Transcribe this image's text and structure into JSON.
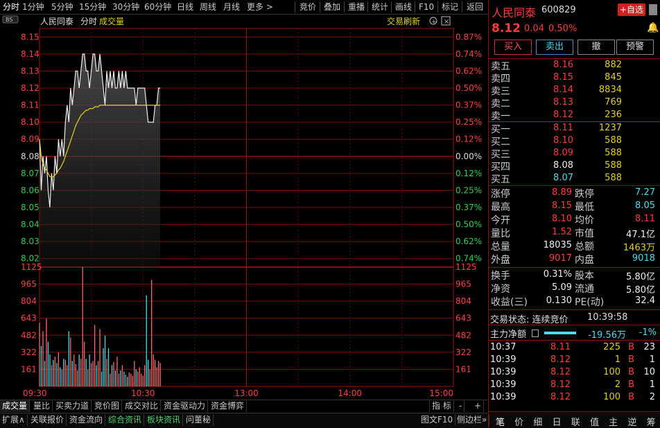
{
  "toolbar": {
    "left_items": [
      "分时",
      "1分钟",
      "5分钟",
      "15分钟",
      "30分钟",
      "60分钟",
      "日线",
      "周线",
      "月线",
      "更多 >"
    ],
    "right_items": [
      "竞价",
      "叠加",
      "重播",
      "统计",
      "画线",
      "F10",
      "标记",
      "返回"
    ]
  },
  "chart": {
    "corner_badge": "BS",
    "stock_name": "人民同泰",
    "mode_label": "分时",
    "indicator_label": "成交量",
    "refresh_label": "交易刷新",
    "price_ticks": [
      "8.15",
      "8.14",
      "8.13",
      "8.12",
      "8.11",
      "8.10",
      "8.09",
      "8.08",
      "8.07",
      "8.06",
      "8.05",
      "8.04",
      "8.03",
      "8.02"
    ],
    "pct_ticks": [
      "0.87%",
      "0.74%",
      "0.62%",
      "0.50%",
      "0.37%",
      "0.25%",
      "0.12%",
      "0.00%",
      "0.12%",
      "0.25%",
      "0.37%",
      "0.50%",
      "0.62%",
      "0.74%"
    ],
    "volume_ticks": [
      "1125",
      "965",
      "804",
      "643",
      "482",
      "322",
      "161"
    ],
    "time_ticks": [
      "09:30",
      "10:30",
      "13:00",
      "14:00",
      "15:00"
    ]
  },
  "chart_data": {
    "type": "line",
    "prev_close": 8.08,
    "ylim": [
      8.015,
      8.155
    ],
    "x_range_minutes": [
      0,
      240
    ],
    "series": [
      {
        "values_minute": [
          0,
          1,
          2,
          3,
          4,
          5,
          6,
          7,
          8,
          9,
          10,
          11,
          12,
          13,
          14,
          15,
          16,
          17,
          18,
          19,
          20,
          21,
          22,
          23,
          24,
          25,
          26,
          27,
          28,
          29,
          30,
          31,
          32,
          33,
          34,
          35,
          36,
          37,
          38,
          39,
          40,
          41,
          42,
          43,
          44,
          45,
          46,
          47,
          48,
          49,
          50,
          51,
          52,
          53,
          54,
          55,
          56,
          57,
          58,
          59,
          60,
          61,
          62,
          63,
          64,
          65,
          66,
          67,
          68,
          69,
          70
        ],
        "price": [
          8.09,
          8.06,
          8.08,
          8.07,
          8.08,
          8.06,
          8.05,
          8.07,
          8.06,
          8.08,
          8.07,
          8.09,
          8.08,
          8.09,
          8.08,
          8.1,
          8.11,
          8.1,
          8.12,
          8.11,
          8.12,
          8.13,
          8.13,
          8.12,
          8.13,
          8.14,
          8.14,
          8.13,
          8.13,
          8.12,
          8.13,
          8.14,
          8.14,
          8.13,
          8.13,
          8.14,
          8.13,
          8.12,
          8.11,
          8.13,
          8.12,
          8.13,
          8.12,
          8.13,
          8.12,
          8.12,
          8.13,
          8.12,
          8.13,
          8.12,
          8.13,
          8.12,
          8.12,
          8.12,
          8.12,
          8.12,
          8.11,
          8.12,
          8.12,
          8.12,
          8.12,
          8.12,
          8.11,
          8.1,
          8.1,
          8.1,
          8.1,
          8.11,
          8.11,
          8.12,
          8.12
        ],
        "avg": [
          8.09,
          8.08,
          8.075,
          8.073,
          8.072,
          8.07,
          8.068,
          8.068,
          8.068,
          8.069,
          8.07,
          8.072,
          8.073,
          8.075,
          8.077,
          8.08,
          8.083,
          8.086,
          8.089,
          8.092,
          8.095,
          8.098,
          8.1,
          8.102,
          8.104,
          8.105,
          8.106,
          8.107,
          8.107,
          8.108,
          8.108,
          8.108,
          8.109,
          8.109,
          8.109,
          8.11,
          8.11,
          8.11,
          8.11,
          8.11,
          8.11,
          8.11,
          8.11,
          8.11,
          8.11,
          8.11,
          8.11,
          8.11,
          8.11,
          8.11,
          8.11,
          8.11,
          8.11,
          8.11,
          8.11,
          8.11,
          8.11,
          8.11,
          8.11,
          8.11,
          8.11,
          8.11,
          8.11,
          8.11,
          8.11,
          8.11,
          8.11,
          8.11,
          8.11,
          8.11,
          8.11
        ]
      }
    ],
    "volume": [
      600,
      380,
      520,
      240,
      640,
      420,
      300,
      200,
      250,
      280,
      220,
      320,
      180,
      160,
      260,
      250,
      200,
      520,
      460,
      240,
      300,
      210,
      150,
      300,
      260,
      1125,
      420,
      260,
      160,
      300,
      220,
      240,
      580,
      200,
      240,
      540,
      140,
      360,
      480,
      260,
      360,
      120,
      200,
      230,
      150,
      280,
      120,
      150,
      200,
      140,
      110,
      90,
      130,
      120,
      100,
      240,
      160,
      140,
      180,
      120,
      100,
      200,
      860,
      250,
      160,
      1005,
      300,
      250,
      180,
      240,
      220
    ],
    "ylim_volume": [
      0,
      1125
    ]
  },
  "bottom_tabs": [
    "成交量",
    "量比",
    "买卖力道",
    "竞价图",
    "成交对比",
    "资金驱动力",
    "资金博弈"
  ],
  "bottom_right": {
    "indicator": "指 标",
    "minus": "-",
    "plus": "+"
  },
  "status_bar": {
    "left": [
      "扩展∧",
      "关联报价",
      "资金流向",
      "综合资讯",
      "板块资讯",
      "问董秘"
    ],
    "right": [
      "图文F10",
      "侧边栏»"
    ]
  },
  "quote": {
    "name": "人民同泰",
    "code": "600829",
    "add_button": "+自选",
    "price": "8.12",
    "change": "0.04",
    "change_pct": "0.50%",
    "buttons": [
      "买入",
      "卖出",
      "撤",
      "预警"
    ],
    "asks": [
      {
        "label": "卖五",
        "price": "8.16",
        "vol": "882"
      },
      {
        "label": "卖四",
        "price": "8.15",
        "vol": "845"
      },
      {
        "label": "卖三",
        "price": "8.14",
        "vol": "8834"
      },
      {
        "label": "卖二",
        "price": "8.13",
        "vol": "769"
      },
      {
        "label": "卖一",
        "price": "8.12",
        "vol": "236"
      }
    ],
    "bids": [
      {
        "label": "买一",
        "price": "8.11",
        "vol": "1237"
      },
      {
        "label": "买二",
        "price": "8.10",
        "vol": "588"
      },
      {
        "label": "买三",
        "price": "8.09",
        "vol": "588"
      },
      {
        "label": "买四",
        "price": "8.08",
        "vol": "588"
      },
      {
        "label": "买五",
        "price": "8.07",
        "vol": "588"
      }
    ],
    "stats1": [
      {
        "l1": "涨停",
        "v1": "8.89",
        "l2": "跌停",
        "v2": "7.27"
      },
      {
        "l1": "最高",
        "v1": "8.15",
        "l2": "最低",
        "v2": "8.05"
      },
      {
        "l1": "今开",
        "v1": "8.10",
        "l2": "均价",
        "v2": "8.11"
      },
      {
        "l1": "量比",
        "v1": "1.52",
        "l2": "市值",
        "v2": "47.1亿"
      },
      {
        "l1": "总量",
        "v1": "18035",
        "l2": "总额",
        "v2": "1463万"
      },
      {
        "l1": "外盘",
        "v1": "9017",
        "l2": "内盘",
        "v2": "9018"
      }
    ],
    "stats2": [
      {
        "l1": "换手",
        "v1": "0.31%",
        "l2": "股本",
        "v2": "5.80亿"
      },
      {
        "l1": "净资",
        "v1": "5.09",
        "l2": "流通",
        "v2": "5.80亿"
      },
      {
        "l1": "收益(三)",
        "v1": "0.130",
        "l2": "PE(动)",
        "v2": "32.4"
      }
    ],
    "trade_status_label": "交易状态: 连续竞价",
    "trade_status_time": "10:39:58",
    "main_flow_label": "主力净额",
    "main_flow_value": "-19.56万",
    "main_flow_pct": "-1%",
    "ticks": [
      {
        "time": "10:37",
        "price": "8.11",
        "vol": "225",
        "side": "B",
        "n": "23"
      },
      {
        "time": "10:39",
        "price": "8.12",
        "vol": "1",
        "side": "B",
        "n": "1"
      },
      {
        "time": "10:39",
        "price": "8.12",
        "vol": "100",
        "side": "B",
        "n": "10"
      },
      {
        "time": "10:39",
        "price": "8.12",
        "vol": "2",
        "side": "B",
        "n": "1"
      },
      {
        "time": "10:39",
        "price": "8.12",
        "vol": "100",
        "side": "B",
        "n": "2"
      }
    ],
    "bottom_tabs": [
      "笔",
      "价",
      "细",
      "日",
      "联",
      "值",
      "主",
      "逆",
      "筹"
    ]
  }
}
